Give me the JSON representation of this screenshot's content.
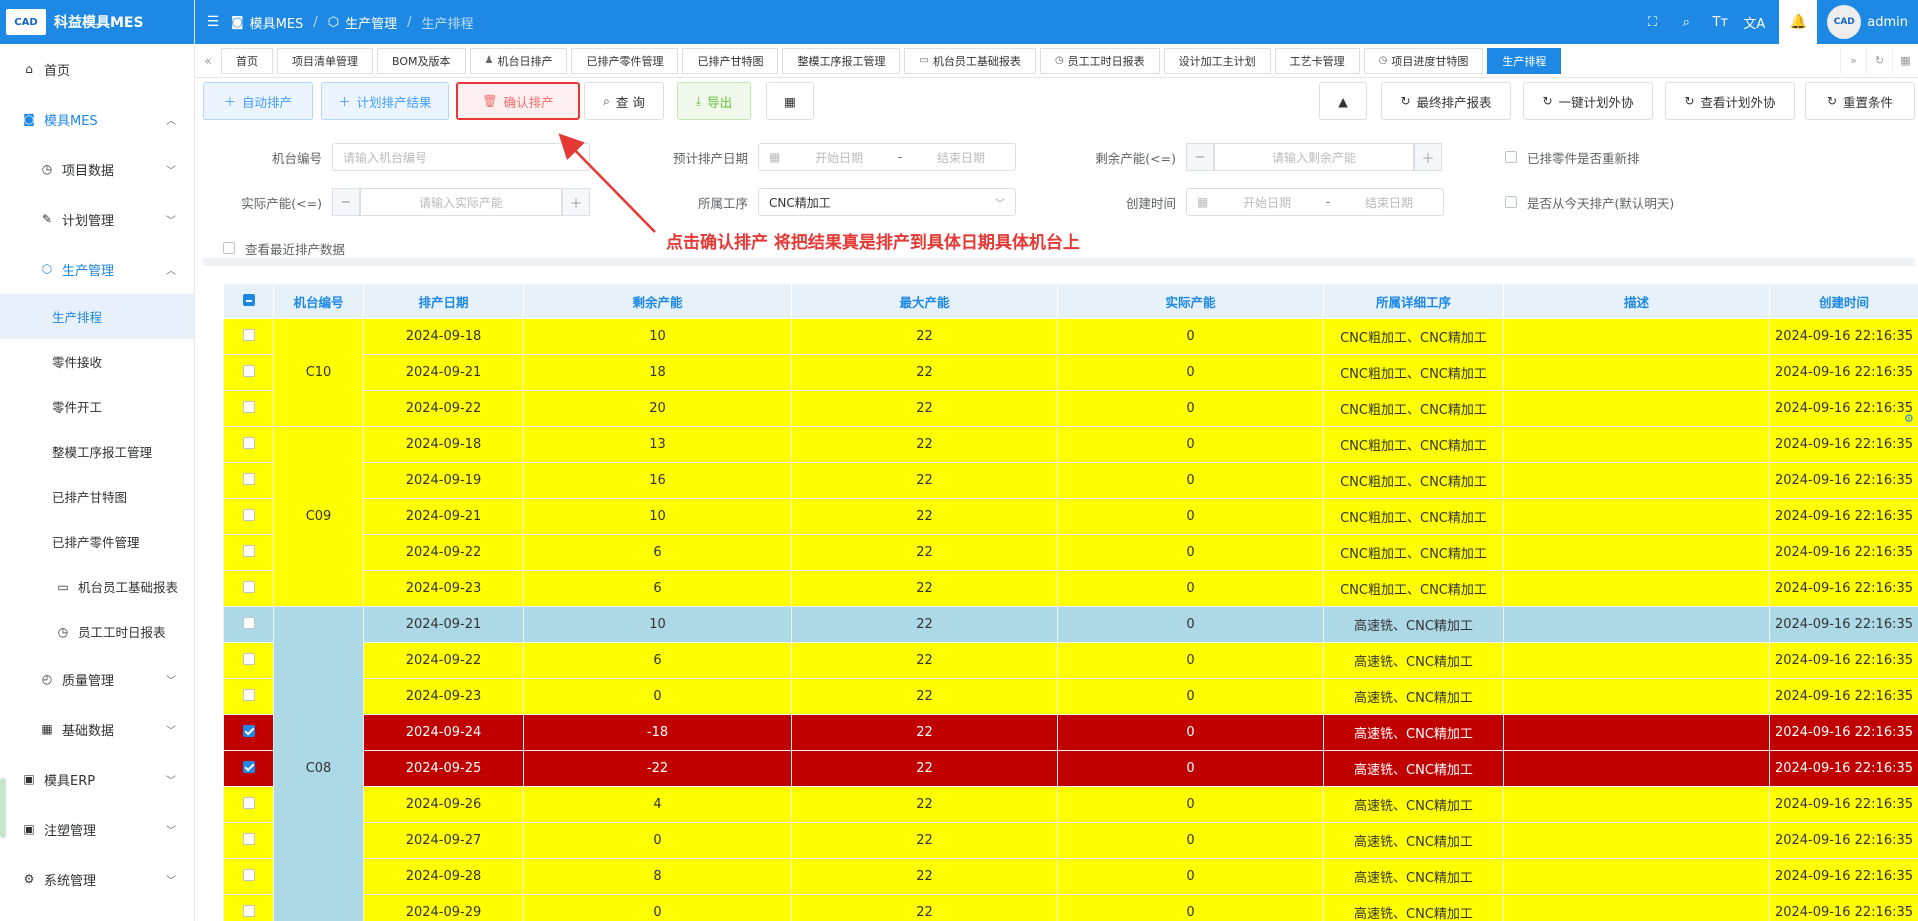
{
  "app": {
    "name": "科益模具MES",
    "logo_text": "CAD"
  },
  "sidebar": {
    "home": "首页",
    "mes": "模具MES",
    "project_data": "项目数据",
    "plan_mgmt": "计划管理",
    "prod_mgmt": "生产管理",
    "prod_items": [
      "生产排程",
      "零件接收",
      "零件开工",
      "整模工序报工管理",
      "已排产甘特图",
      "已排产零件管理",
      "机台员工基础报表",
      "员工工时日报表"
    ],
    "quality": "质量管理",
    "base_data": "基础数据",
    "erp": "模具ERP",
    "injection": "注塑管理",
    "system": "系统管理"
  },
  "header": {
    "crumbs": [
      "模具MES",
      "生产管理",
      "生产排程"
    ],
    "user": "admin",
    "avatar_text": "CAD"
  },
  "tabs": [
    "首页",
    "项目清单管理",
    "BOM及版本",
    "机台日排产",
    "已排产零件管理",
    "已排产甘特图",
    "整模工序报工管理",
    "机台员工基础报表",
    "员工工时日报表",
    "设计加工主计划",
    "工艺卡管理",
    "项目进度甘特图",
    "生产排程"
  ],
  "toolbar": {
    "auto": "自动排产",
    "plan_result": "计划排产结果",
    "confirm": "确认排产",
    "query": "查 询",
    "export": "导出",
    "final_report": "最终排产报表",
    "one_click": "一键计划外协",
    "view_outsource": "查看计划外协",
    "reset": "重置条件"
  },
  "filters": {
    "machine_label": "机台编号",
    "machine_ph": "请输入机台编号",
    "date_label": "预计排产日期",
    "start_ph": "开始日期",
    "end_ph": "结束日期",
    "dash": "-",
    "remain_label": "剩余产能(<=)",
    "remain_ph": "请输入剩余产能",
    "rearrange": "已排零件是否重新排",
    "actual_label": "实际产能(<=)",
    "actual_ph": "请输入实际产能",
    "process_label": "所属工序",
    "process_val": "CNC精加工",
    "created_label": "创建时间",
    "from_today": "是否从今天排产(默认明天)",
    "recent": "查看最近排产数据"
  },
  "annotation": "点击确认排产 将把结果真是排产到具体日期具体机台上",
  "table": {
    "headers": [
      "机台编号",
      "排产日期",
      "剩余产能",
      "最大产能",
      "实际产能",
      "所属详细工序",
      "描述",
      "创建时间"
    ],
    "groups": [
      {
        "machine": "C10",
        "color": "y",
        "rows": [
          {
            "date": "2024-09-18",
            "remain": "10",
            "max": "22",
            "actual": "0",
            "process": "CNC粗加工、CNC精加工",
            "desc": "",
            "created": "2024-09-16 22:16:35",
            "style": "y",
            "checked": false
          },
          {
            "date": "2024-09-21",
            "remain": "18",
            "max": "22",
            "actual": "0",
            "process": "CNC粗加工、CNC精加工",
            "desc": "",
            "created": "2024-09-16 22:16:35",
            "style": "y",
            "checked": false
          },
          {
            "date": "2024-09-22",
            "remain": "20",
            "max": "22",
            "actual": "0",
            "process": "CNC粗加工、CNC精加工",
            "desc": "",
            "created": "2024-09-16 22:16:35",
            "style": "y",
            "checked": false
          }
        ]
      },
      {
        "machine": "C09",
        "color": "y",
        "rows": [
          {
            "date": "2024-09-18",
            "remain": "13",
            "max": "22",
            "actual": "0",
            "process": "CNC粗加工、CNC精加工",
            "desc": "",
            "created": "2024-09-16 22:16:35",
            "style": "y",
            "checked": false
          },
          {
            "date": "2024-09-19",
            "remain": "16",
            "max": "22",
            "actual": "0",
            "process": "CNC粗加工、CNC精加工",
            "desc": "",
            "created": "2024-09-16 22:16:35",
            "style": "y",
            "checked": false
          },
          {
            "date": "2024-09-21",
            "remain": "10",
            "max": "22",
            "actual": "0",
            "process": "CNC粗加工、CNC精加工",
            "desc": "",
            "created": "2024-09-16 22:16:35",
            "style": "y",
            "checked": false
          },
          {
            "date": "2024-09-22",
            "remain": "6",
            "max": "22",
            "actual": "0",
            "process": "CNC粗加工、CNC精加工",
            "desc": "",
            "created": "2024-09-16 22:16:35",
            "style": "y",
            "checked": false
          },
          {
            "date": "2024-09-23",
            "remain": "6",
            "max": "22",
            "actual": "0",
            "process": "CNC粗加工、CNC精加工",
            "desc": "",
            "created": "2024-09-16 22:16:35",
            "style": "y",
            "checked": false
          }
        ]
      },
      {
        "machine": "C08",
        "color": "g",
        "rows": [
          {
            "date": "2024-09-21",
            "remain": "10",
            "max": "22",
            "actual": "0",
            "process": "高速铣、CNC精加工",
            "desc": "",
            "created": "2024-09-16 22:16:35",
            "style": "g",
            "checked": false
          },
          {
            "date": "2024-09-22",
            "remain": "6",
            "max": "22",
            "actual": "0",
            "process": "高速铣、CNC精加工",
            "desc": "",
            "created": "2024-09-16 22:16:35",
            "style": "y",
            "checked": false
          },
          {
            "date": "2024-09-23",
            "remain": "0",
            "max": "22",
            "actual": "0",
            "process": "高速铣、CNC精加工",
            "desc": "",
            "created": "2024-09-16 22:16:35",
            "style": "y",
            "checked": false
          },
          {
            "date": "2024-09-24",
            "remain": "-18",
            "max": "22",
            "actual": "0",
            "process": "高速铣、CNC精加工",
            "desc": "",
            "created": "2024-09-16 22:16:35",
            "style": "r",
            "checked": true
          },
          {
            "date": "2024-09-25",
            "remain": "-22",
            "max": "22",
            "actual": "0",
            "process": "高速铣、CNC精加工",
            "desc": "",
            "created": "2024-09-16 22:16:35",
            "style": "r",
            "checked": true
          },
          {
            "date": "2024-09-26",
            "remain": "4",
            "max": "22",
            "actual": "0",
            "process": "高速铣、CNC精加工",
            "desc": "",
            "created": "2024-09-16 22:16:35",
            "style": "y",
            "checked": false
          },
          {
            "date": "2024-09-27",
            "remain": "0",
            "max": "22",
            "actual": "0",
            "process": "高速铣、CNC精加工",
            "desc": "",
            "created": "2024-09-16 22:16:35",
            "style": "y",
            "checked": false
          },
          {
            "date": "2024-09-28",
            "remain": "8",
            "max": "22",
            "actual": "0",
            "process": "高速铣、CNC精加工",
            "desc": "",
            "created": "2024-09-16 22:16:35",
            "style": "y",
            "checked": false
          },
          {
            "date": "2024-09-29",
            "remain": "0",
            "max": "22",
            "actual": "0",
            "process": "高速铣、CNC精加工",
            "desc": "",
            "created": "2024-09-16 22:16:35",
            "style": "y",
            "checked": false
          }
        ]
      }
    ]
  },
  "colors": {
    "primary": "#1e88e5",
    "row_yellow": "#ffff00",
    "row_blue": "#add8e6",
    "row_red": "#c00000",
    "annotation": "#e53935"
  }
}
